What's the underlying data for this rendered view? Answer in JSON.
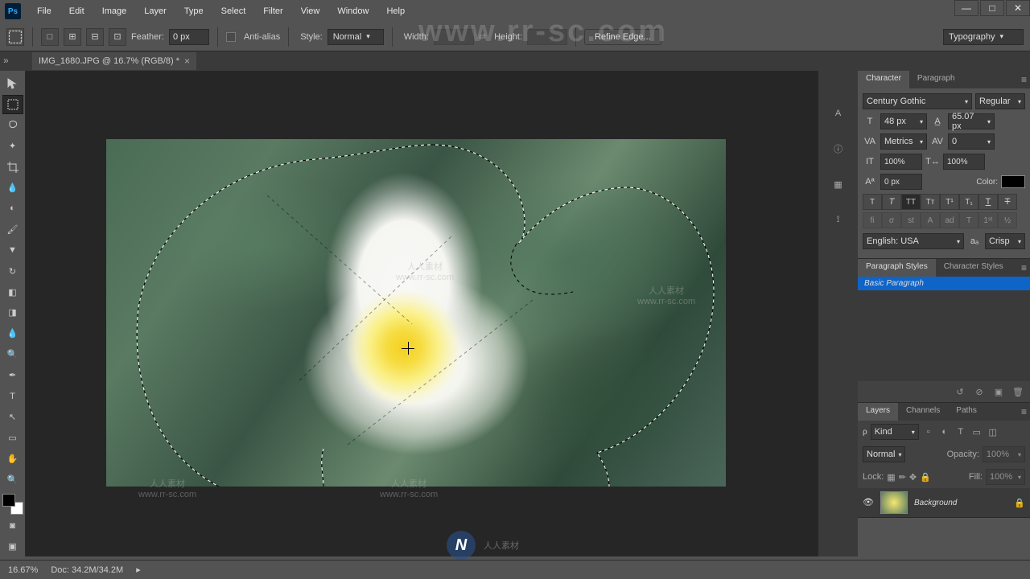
{
  "app_logo": "Ps",
  "menu": [
    "File",
    "Edit",
    "Image",
    "Layer",
    "Type",
    "Select",
    "Filter",
    "View",
    "Window",
    "Help"
  ],
  "options_bar": {
    "feather_label": "Feather:",
    "feather_value": "0 px",
    "anti_alias": "Anti-alias",
    "style_label": "Style:",
    "style_value": "Normal",
    "width_label": "Width:",
    "height_label": "Height:",
    "refine_edge": "Refine Edge...",
    "workspace": "Typography"
  },
  "document": {
    "tab_title": "IMG_1680.JPG @ 16.7% (RGB/8) *"
  },
  "watermarks": {
    "url": "www.rr-sc.com",
    "text_cn": "人人素材",
    "footer": "人人素材"
  },
  "character_panel": {
    "tabs": [
      "Character",
      "Paragraph"
    ],
    "font_family": "Century Gothic",
    "font_style": "Regular",
    "font_size": "48 px",
    "leading": "65.07 px",
    "kerning": "Metrics",
    "tracking": "0",
    "vscale": "100%",
    "hscale": "100%",
    "baseline": "0 px",
    "color_label": "Color:",
    "language": "English: USA",
    "aa": "Crisp"
  },
  "paragraph_styles": {
    "tabs": [
      "Paragraph Styles",
      "Character Styles"
    ],
    "items": [
      "Basic Paragraph"
    ]
  },
  "layers_panel": {
    "tabs": [
      "Layers",
      "Channels",
      "Paths"
    ],
    "kind_label": "Kind",
    "blend_mode": "Normal",
    "opacity_label": "Opacity:",
    "opacity_value": "100%",
    "lock_label": "Lock:",
    "fill_label": "Fill:",
    "fill_value": "100%",
    "layer0": "Background"
  },
  "status_bar": {
    "zoom": "16.67%",
    "doc_info": "Doc: 34.2M/34.2M"
  }
}
